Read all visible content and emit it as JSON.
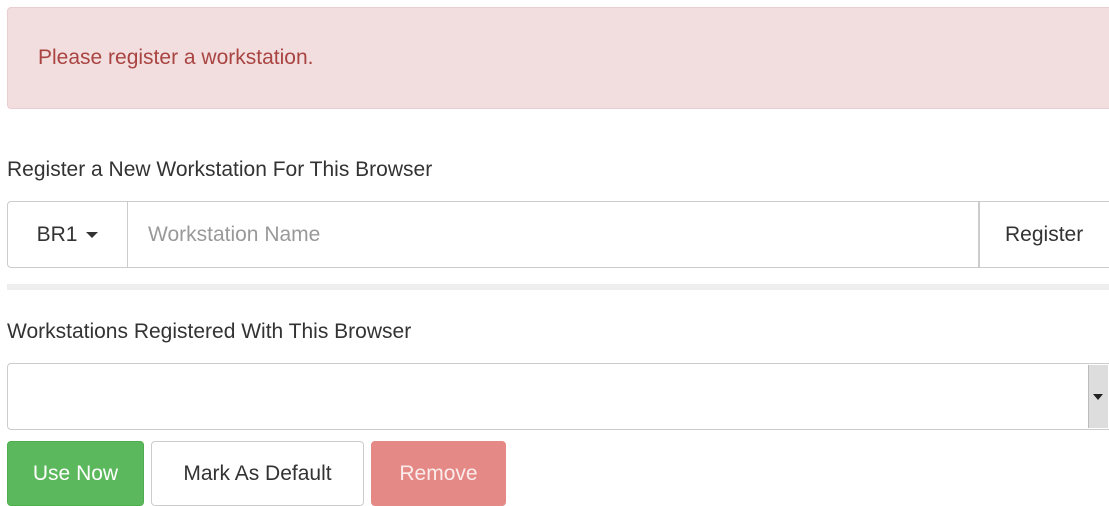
{
  "alert": {
    "message": "Please register a workstation."
  },
  "register_section": {
    "heading": "Register a New Workstation For This Browser",
    "org_dropdown_value": "BR1",
    "name_placeholder": "Workstation Name",
    "register_button": "Register"
  },
  "registered_section": {
    "heading": "Workstations Registered With This Browser",
    "selected_value": ""
  },
  "actions": {
    "use_now": "Use Now",
    "mark_default": "Mark As Default",
    "remove": "Remove"
  },
  "colors": {
    "alert_bg": "#f2dede",
    "alert_text": "#a94442",
    "success": "#5cb85c",
    "danger_disabled": "#e58986"
  },
  "icons": [
    "caret-down-icon",
    "select-arrow-icon"
  ]
}
